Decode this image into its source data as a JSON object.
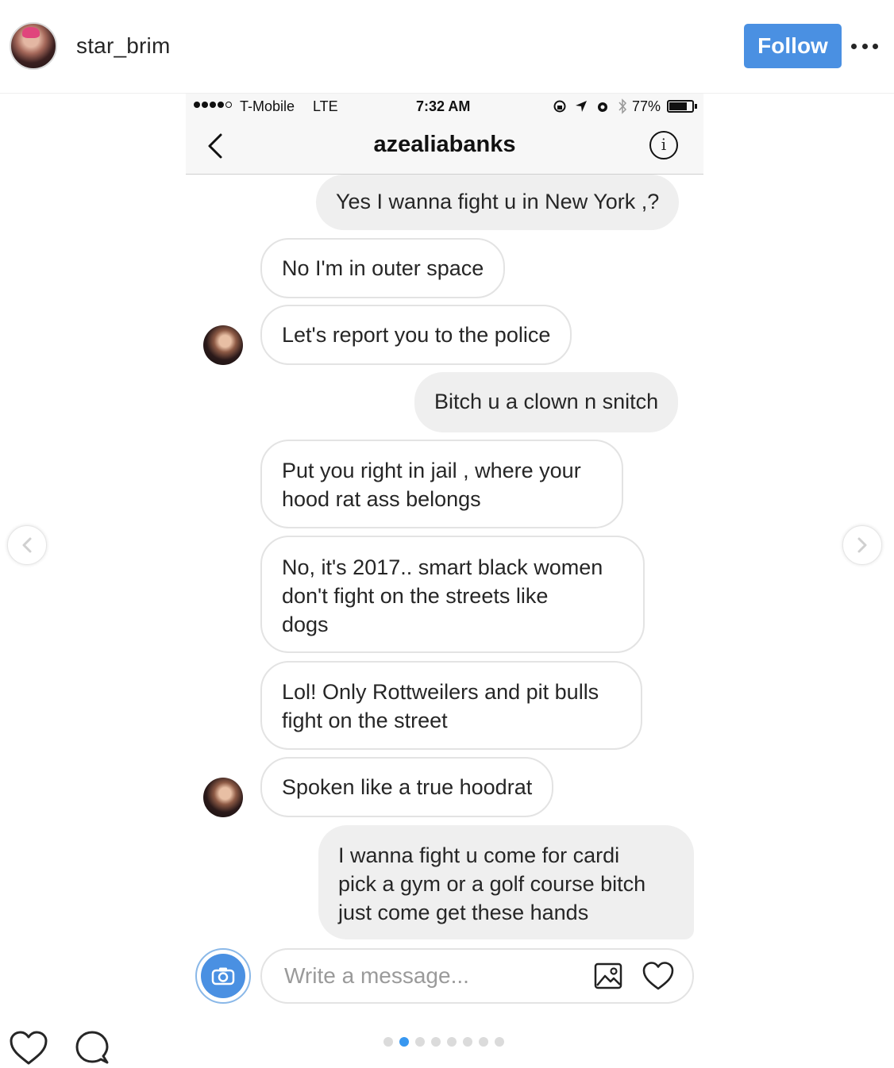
{
  "post": {
    "username": "star_brim",
    "follow_label": "Follow"
  },
  "status_bar": {
    "carrier": "T-Mobile",
    "network": "LTE",
    "time": "7:32 AM",
    "battery": "77%"
  },
  "thread": {
    "title": "azealiabanks"
  },
  "messages": [
    {
      "from": "me",
      "lines": [
        "Yes I wanna fight u in New York ,?"
      ]
    },
    {
      "from": "them",
      "lines": [
        "No I'm in outer space"
      ]
    },
    {
      "from": "them",
      "lines": [
        "Let's report you to the police"
      ]
    },
    {
      "from": "me",
      "lines": [
        "Bitch u a clown n snitch"
      ]
    },
    {
      "from": "them",
      "lines": [
        "Put you right in jail , where your",
        "hood rat ass belongs"
      ]
    },
    {
      "from": "them",
      "lines": [
        "No, it's 2017.. smart black women",
        "don't fight on the streets like",
        "dogs"
      ]
    },
    {
      "from": "them",
      "lines": [
        "Lol! Only Rottweilers and pit bulls",
        "fight on the street"
      ]
    },
    {
      "from": "them",
      "lines": [
        "Spoken like a true hoodrat"
      ]
    },
    {
      "from": "me",
      "lines": [
        "I wanna fight u come for cardi",
        "pick a gym or a golf course bitch",
        "just come get these hands"
      ]
    }
  ],
  "composer": {
    "placeholder": "Write a message..."
  },
  "carousel": {
    "total_slides": 8,
    "active_slide": 2
  },
  "icons": {
    "back": "chevron-left-icon",
    "info": "info-icon",
    "camera": "camera-icon",
    "gallery": "image-icon",
    "heart": "heart-icon",
    "comment": "comment-icon",
    "more": "more-icon"
  },
  "colors": {
    "follow_button": "#4a90e2",
    "active_dot": "#3897f0",
    "camera_button": "#4a90e2",
    "my_bubble": "#efefef",
    "their_bubble_border": "#e3e3e3"
  }
}
